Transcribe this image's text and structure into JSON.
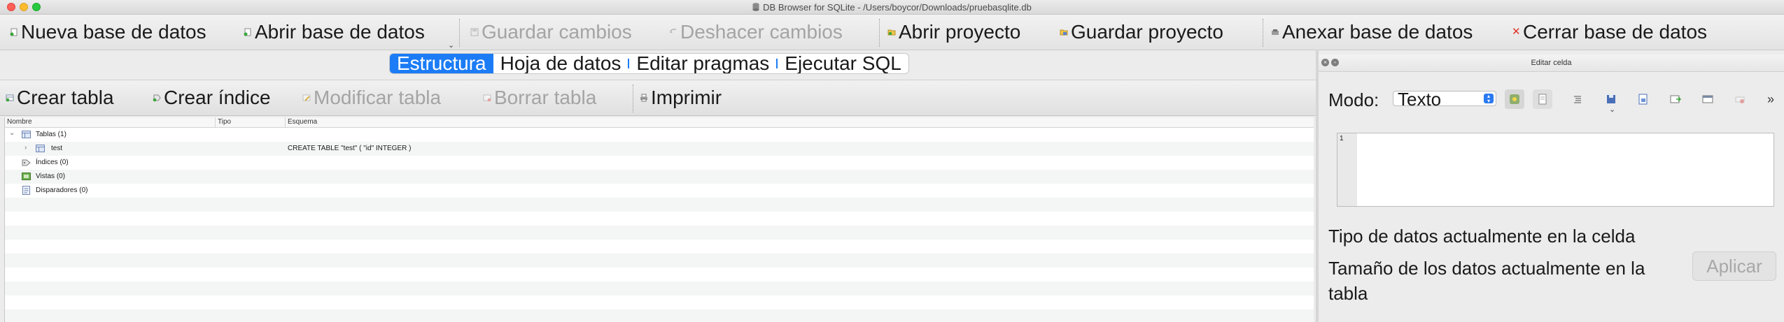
{
  "window": {
    "title": "DB Browser for SQLite - /Users/boycor/Downloads/pruebasqlite.db"
  },
  "toolbar": {
    "new_db": "Nueva base de datos",
    "open_db": "Abrir base de datos",
    "save_changes": "Guardar cambios",
    "undo_changes": "Deshacer cambios",
    "open_project": "Abrir proyecto",
    "save_project": "Guardar proyecto",
    "attach_db": "Anexar base de datos",
    "close_db": "Cerrar base de datos"
  },
  "tabs": [
    {
      "label": "Estructura",
      "active": true
    },
    {
      "label": "Hoja de datos",
      "active": false
    },
    {
      "label": "Editar pragmas",
      "active": false
    },
    {
      "label": "Ejecutar SQL",
      "active": false
    }
  ],
  "structure_toolbar": {
    "create_table": "Crear tabla",
    "create_index": "Crear índice",
    "modify_table": "Modificar tabla",
    "delete_table": "Borrar tabla",
    "print": "Imprimir"
  },
  "tree": {
    "columns": [
      "Nombre",
      "Tipo",
      "Esquema"
    ],
    "rows": [
      {
        "name": "Tablas (1)",
        "type": "",
        "schema": "",
        "icon": "table-icon",
        "expanded": true,
        "level": 0
      },
      {
        "name": "test",
        "type": "",
        "schema": "CREATE TABLE \"test\" ( \"id\" INTEGER )",
        "icon": "table-icon",
        "expanded": false,
        "level": 1
      },
      {
        "name": "Índices (0)",
        "type": "",
        "schema": "",
        "icon": "index-icon",
        "level": 0
      },
      {
        "name": "Vistas (0)",
        "type": "",
        "schema": "",
        "icon": "view-icon",
        "level": 0
      },
      {
        "name": "Disparadores (0)",
        "type": "",
        "schema": "",
        "icon": "trigger-icon",
        "level": 0
      }
    ]
  },
  "edit_cell": {
    "title": "Editar celda",
    "mode_label": "Modo:",
    "mode_value": "Texto",
    "line_number": "1",
    "data_type_label": "Tipo de datos actualmente en la celda",
    "data_size_label_line1": "Tamaño de los datos actualmente en la",
    "data_size_label_line2": "tabla",
    "apply_button": "Aplicar"
  },
  "colors": {
    "accent": "#1b7cf5",
    "disabled_text": "#a4a4a4",
    "close_icon": "#e0342b"
  }
}
